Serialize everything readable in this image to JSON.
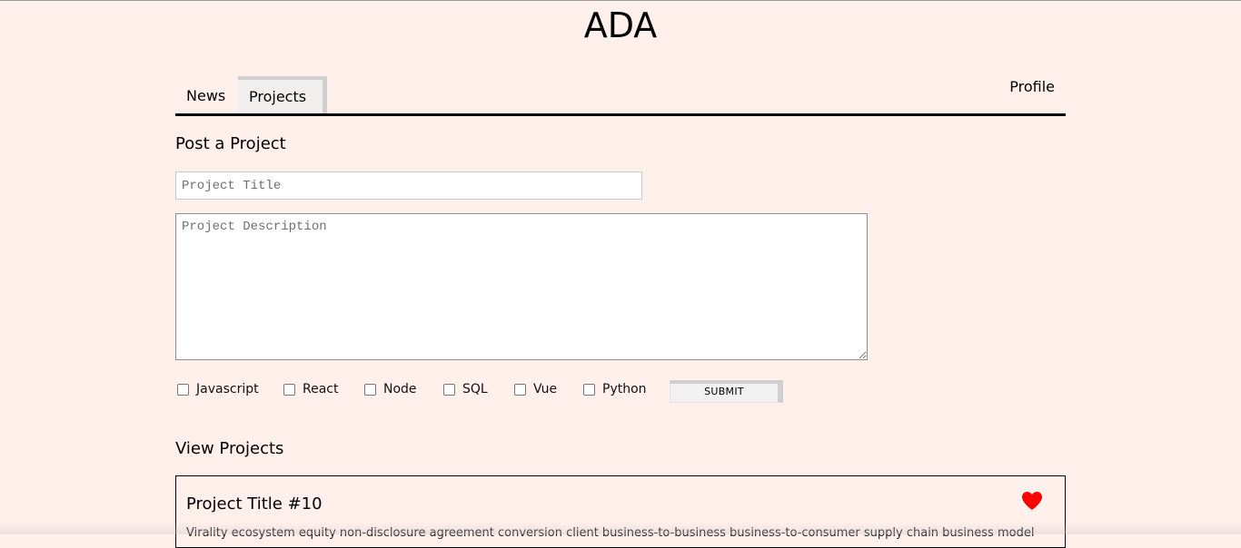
{
  "header": {
    "logo": "ADA"
  },
  "nav": {
    "tabs": [
      {
        "label": "News"
      },
      {
        "label": "Projects"
      }
    ],
    "profile_label": "Profile"
  },
  "post": {
    "heading": "Post a Project",
    "title_placeholder": "Project Title",
    "description_placeholder": "Project Description",
    "tags": [
      "Javascript",
      "React",
      "Node",
      "SQL",
      "Vue",
      "Python"
    ],
    "submit_label": "SUBMIT"
  },
  "view": {
    "heading": "View Projects",
    "projects": [
      {
        "title": "Project Title #10",
        "description": "Virality ecosystem equity non-disclosure agreement conversion client business-to-business business-to-consumer supply chain business model",
        "liked": true
      }
    ]
  },
  "colors": {
    "background": "#fff0ec",
    "heart": "#ff0000",
    "rule": "#000000"
  },
  "icons": {
    "heart": "heart-icon"
  }
}
